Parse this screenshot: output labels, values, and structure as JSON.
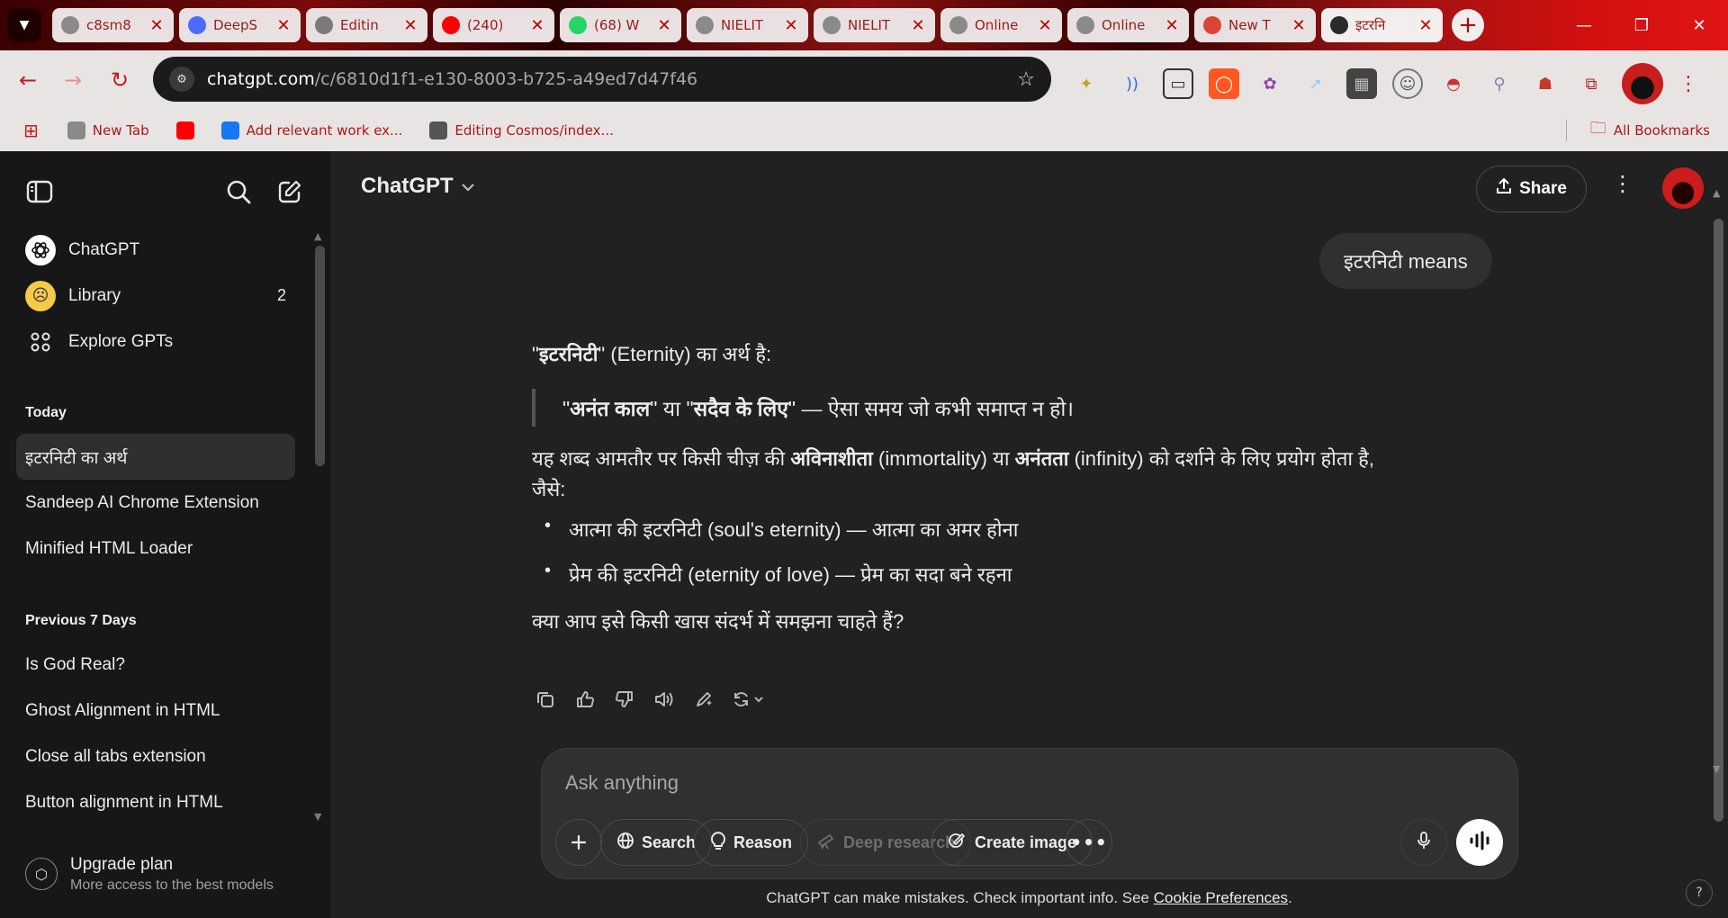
{
  "browser": {
    "tabs": [
      {
        "title": "c8sm8",
        "icon": "globe-icon",
        "color": "#8a8a8a"
      },
      {
        "title": "DeepS",
        "icon": "deepseek-icon",
        "color": "#4d6bfe"
      },
      {
        "title": "Editin",
        "icon": "github-icon",
        "color": "#7a7a7a"
      },
      {
        "title": "(240) ",
        "icon": "youtube-icon",
        "color": "#ff0000"
      },
      {
        "title": "(68) W",
        "icon": "whatsapp-icon",
        "color": "#25d366"
      },
      {
        "title": "NIELIT",
        "icon": "globe-icon",
        "color": "#8a8a8a"
      },
      {
        "title": "NIELIT",
        "icon": "globe-icon",
        "color": "#8a8a8a"
      },
      {
        "title": "Online",
        "icon": "globe-icon",
        "color": "#8a8a8a"
      },
      {
        "title": "Online",
        "icon": "globe-icon",
        "color": "#8a8a8a"
      },
      {
        "title": "New T",
        "icon": "chrome-icon",
        "color": "#db4437"
      },
      {
        "title": "इटरनि",
        "icon": "chatgpt-icon",
        "color": "#2a2a2a"
      }
    ],
    "url_host": "chatgpt.com",
    "url_path": "/c/6810d1f1-e130-8003-b725-a49ed7d47f46",
    "bookmarks": [
      {
        "label": "New Tab",
        "icon": "globe-icon",
        "color": "#8a8a8a"
      },
      {
        "label": "",
        "icon": "youtube-icon",
        "color": "#ff0000"
      },
      {
        "label": "Add relevant work ex...",
        "icon": "facebook-icon",
        "color": "#1877f2"
      },
      {
        "label": "Editing Cosmos/index...",
        "icon": "github-icon",
        "color": "#555555"
      }
    ],
    "all_bookmarks": "All Bookmarks",
    "accent": "#c41a1a"
  },
  "sidebar": {
    "nav": [
      {
        "label": "ChatGPT",
        "icon": "openai-icon"
      },
      {
        "label": "Library",
        "icon": "library-emoji-icon",
        "badge": "2"
      },
      {
        "label": "Explore GPTs",
        "icon": "grid-icon"
      }
    ],
    "sections": [
      {
        "title": "Today",
        "chats": [
          "इटरनिटी का अर्थ",
          "Sandeep AI Chrome Extension",
          "Minified HTML Loader"
        ]
      },
      {
        "title": "Previous 7 Days",
        "chats": [
          "Is God Real?",
          "Ghost Alignment in HTML",
          "Close all tabs extension",
          "Button alignment in HTML"
        ]
      }
    ],
    "upgrade": {
      "title": "Upgrade plan",
      "subtitle": "More access to the best models"
    }
  },
  "header": {
    "model": "ChatGPT",
    "share": "Share"
  },
  "conversation": {
    "user_message": "इटरनिटी  means",
    "assistant": {
      "l1_q1": "\"",
      "l1_b": "इटरनिटी",
      "l1_rest": "\" (Eternity) का अर्थ है:",
      "quote_q1": "\"",
      "quote_b1": "अनंत काल",
      "quote_mid": "\" या \"",
      "quote_b2": "सदैव के लिए",
      "quote_rest": "\" — ऐसा समय जो कभी समाप्त न हो।",
      "p_a": "यह शब्द आमतौर पर किसी चीज़ की ",
      "p_b1": "अविनाशीता",
      "p_c": " (immortality) या ",
      "p_b2": "अनंतता",
      "p_d": " (infinity) को दर्शाने के लिए प्रयोग होता है,",
      "p_e": "जैसे:",
      "bullets": [
        "आत्मा की इटरनिटी (soul's eternity) — आत्मा का अमर होना",
        "प्रेम की इटरनिटी (eternity of love) — प्रेम का सदा बने रहना"
      ],
      "closing": "क्या आप इसे किसी खास संदर्भ में समझना चाहते हैं?"
    }
  },
  "composer": {
    "placeholder": "Ask anything",
    "search": "Search",
    "reason": "Reason",
    "deep_research": "Deep research",
    "create_image": "Create image"
  },
  "footer": {
    "disclaimer": "ChatGPT can make mistakes. Check important info. See ",
    "link": "Cookie Preferences",
    "end": ".",
    "help": "?"
  }
}
